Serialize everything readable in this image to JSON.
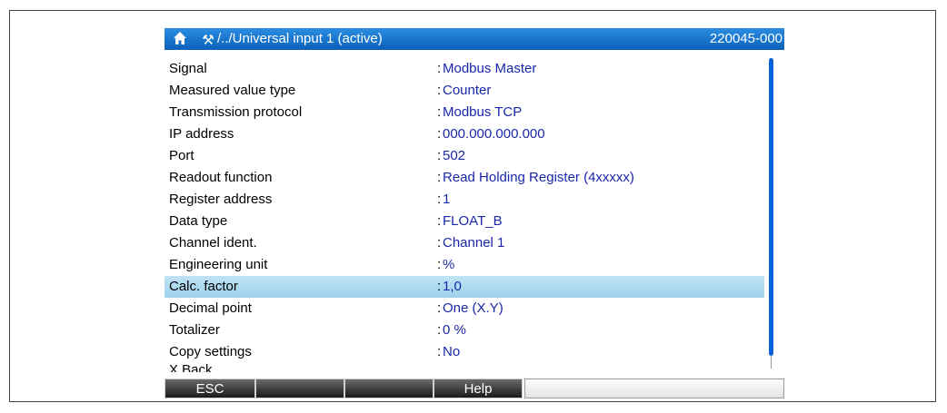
{
  "header": {
    "home_icon": "home-icon",
    "tools_icon": "wrench-icon",
    "tools_glyph": "⚒",
    "path": "/../Universal input 1 (active)",
    "device_id": "220045-000"
  },
  "rows": [
    {
      "label": "Signal",
      "sep": ":",
      "value": "Modbus Master"
    },
    {
      "label": "Measured value type",
      "sep": ":",
      "value": "Counter"
    },
    {
      "label": "Transmission protocol",
      "sep": ":",
      "value": "Modbus TCP"
    },
    {
      "label": "IP address",
      "sep": ":",
      "value": "000.000.000.000"
    },
    {
      "label": "Port",
      "sep": ":",
      "value": "502"
    },
    {
      "label": "Readout function",
      "sep": ":",
      "value": "Read Holding Register (4xxxxx)"
    },
    {
      "label": "Register address",
      "sep": ":",
      "value": "1"
    },
    {
      "label": "Data type",
      "sep": ":",
      "value": "FLOAT_B"
    },
    {
      "label": "Channel ident.",
      "sep": ":",
      "value": "Channel 1"
    },
    {
      "label": "Engineering unit",
      "sep": ":",
      "value": "%"
    },
    {
      "label": "Calc. factor",
      "sep": ":",
      "value": "1,0"
    },
    {
      "label": "Decimal point",
      "sep": ":",
      "value": "One (X.Y)"
    },
    {
      "label": "Totalizer",
      "sep": ":",
      "value": "0 %"
    },
    {
      "label": "Copy settings",
      "sep": ":",
      "value": "No"
    },
    {
      "label": "X Back",
      "sep": "",
      "value": ""
    }
  ],
  "selected_row": "Calc. factor",
  "softkeys": {
    "esc": "ESC",
    "key2": "",
    "key3": "",
    "help": "Help",
    "key5": ""
  },
  "colors": {
    "title_bar": "#1a75d2",
    "value_text": "#1a28a8",
    "selection": "#aad9ef",
    "scrollbar": "#0a63d8"
  }
}
